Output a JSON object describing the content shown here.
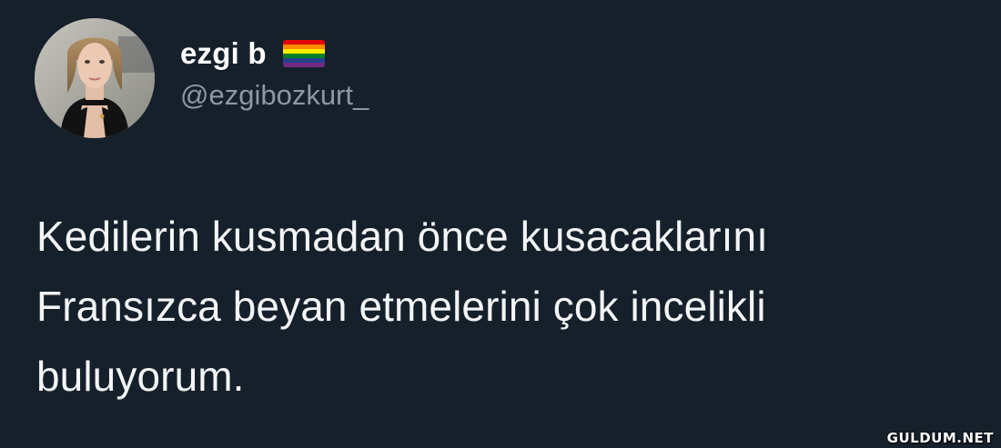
{
  "tweet": {
    "author": {
      "display_name": "ezgi b",
      "handle": "@ezgibozkurt_",
      "name_emoji": "rainbow-flag-icon"
    },
    "text_lines": [
      "Kedilerin kusmadan önce kusacaklarını",
      "Fransızca beyan etmelerini çok incelikli",
      "buluyorum."
    ]
  },
  "watermark": "GULDUM.NET",
  "colors": {
    "background": "#15202b",
    "name": "#ffffff",
    "handle": "#8b98a5",
    "text": "#f2f4f5",
    "flag_stripes": [
      "#e40303",
      "#ff8c00",
      "#ffed00",
      "#008026",
      "#24408e",
      "#732982"
    ]
  }
}
